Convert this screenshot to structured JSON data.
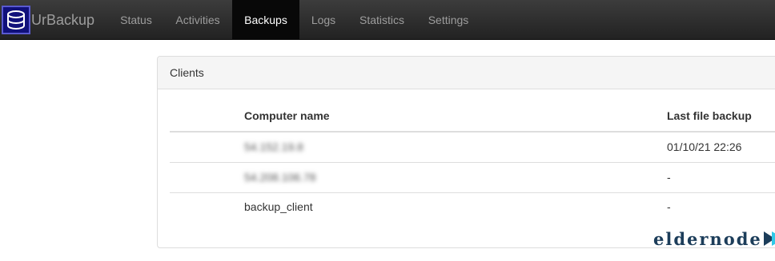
{
  "navbar": {
    "brand": "UrBackup",
    "items": [
      {
        "label": "Status",
        "active": false
      },
      {
        "label": "Activities",
        "active": false
      },
      {
        "label": "Backups",
        "active": true
      },
      {
        "label": "Logs",
        "active": false
      },
      {
        "label": "Statistics",
        "active": false
      },
      {
        "label": "Settings",
        "active": false
      }
    ]
  },
  "panel": {
    "title": "Clients",
    "columns": [
      "Computer name",
      "Last file backup"
    ],
    "rows": [
      {
        "name": "54.152.19.8",
        "last_backup": "01/10/21 22:26",
        "name_blurred": true
      },
      {
        "name": "54.208.106.78",
        "last_backup": "-",
        "name_blurred": true
      },
      {
        "name": "backup_client",
        "last_backup": "-",
        "name_blurred": false
      }
    ]
  },
  "watermark": {
    "text": "eldernode"
  },
  "colors": {
    "navbar_bg": "#222222",
    "active_nav_bg": "#080808",
    "logo_bg": "#10107a",
    "watermark_arrow": "#2ec9e8"
  }
}
